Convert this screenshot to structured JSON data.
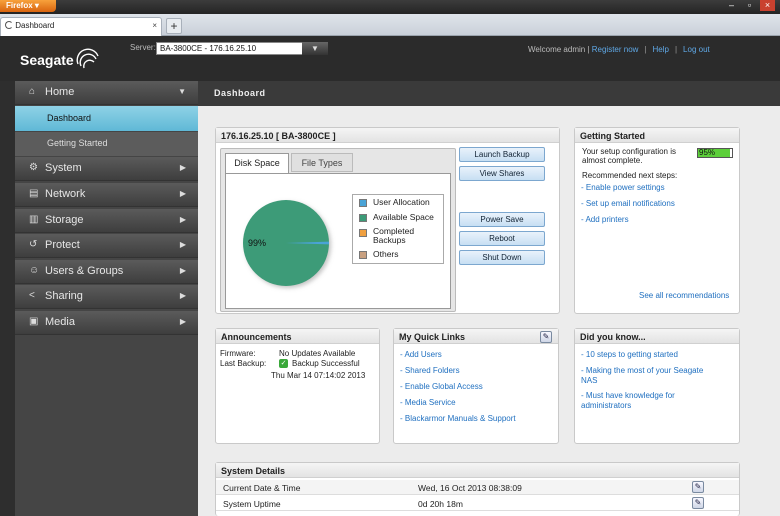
{
  "browser": {
    "app_button": "Firefox",
    "tab_title": "Dashboard",
    "tab_close": "×",
    "new_tab": "+",
    "win_min": "–",
    "win_max": "▫",
    "win_close": "×"
  },
  "header": {
    "logo_text": "Seagate",
    "server_label": "Server:",
    "server_value": "BA-3800CE - 176.16.25.10",
    "welcome": "Welcome admin |",
    "register": "Register now",
    "help": "Help",
    "logout": "Log out",
    "sep": "|"
  },
  "sidebar": {
    "home": "Home",
    "sub_items": [
      "Dashboard",
      "Getting Started"
    ],
    "items": [
      {
        "label": "System",
        "icon": "system-icon"
      },
      {
        "label": "Network",
        "icon": "network-icon"
      },
      {
        "label": "Storage",
        "icon": "storage-icon"
      },
      {
        "label": "Protect",
        "icon": "protect-icon"
      },
      {
        "label": "Users & Groups",
        "icon": "users-icon"
      },
      {
        "label": "Sharing",
        "icon": "sharing-icon"
      },
      {
        "label": "Media",
        "icon": "media-icon"
      }
    ]
  },
  "main": {
    "title": "Dashboard",
    "device": {
      "title": "176.16.25.10 [ BA-3800CE ]",
      "tabs": [
        "Disk Space",
        "File Types"
      ],
      "pie_label": "99%",
      "legend": [
        "User Allocation",
        "Available Space",
        "Completed Backups",
        "Others"
      ],
      "buttons": [
        "Launch Backup",
        "View Shares",
        "Power Save",
        "Reboot",
        "Shut Down"
      ]
    },
    "getting_started": {
      "title": "Getting Started",
      "setup_text": "Your setup configuration is almost complete.",
      "progress_label": "95%",
      "next_steps": "Recommended next steps:",
      "links": [
        "- Enable power settings",
        "- Set up email notifications",
        "- Add printers"
      ],
      "see_all": "See all recommendations"
    },
    "announcements": {
      "title": "Announcements",
      "firmware_label": "Firmware:",
      "firmware_value": "No Updates Available",
      "backup_label": "Last Backup:",
      "backup_value": "Backup Successful",
      "backup_time": "Thu Mar 14 07:14:02 2013"
    },
    "quick_links": {
      "title": "My Quick Links",
      "links": [
        "- Add Users",
        "- Shared Folders",
        "- Enable Global Access",
        "- Media Service",
        "- Blackarmor Manuals & Support"
      ]
    },
    "did_you_know": {
      "title": "Did you know...",
      "links": [
        "- 10 steps to getting started",
        "- Making the most of your Seagate NAS",
        "- Must have knowledge for administrators"
      ]
    },
    "system_details": {
      "title": "System Details",
      "rows": [
        {
          "label": "Current Date & Time",
          "value": "Wed, 16 Oct 2013 08:38:09"
        },
        {
          "label": "System Uptime",
          "value": "0d 20h 18m"
        }
      ]
    }
  },
  "colors": {
    "pie_available": "#3c9b78",
    "pie_user": "#4aa3d6",
    "legend_backups": "#f0a040",
    "legend_others": "#c8a080",
    "progress_fill": "#5ccf3a"
  },
  "chart_data": {
    "type": "pie",
    "categories": [
      "User Allocation",
      "Available Space",
      "Completed Backups",
      "Others"
    ],
    "values": [
      1,
      99,
      0,
      0
    ]
  }
}
